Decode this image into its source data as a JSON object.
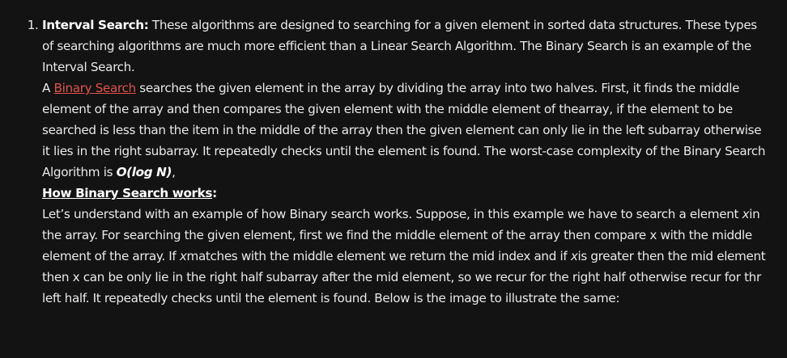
{
  "item_number": "1.",
  "intro": {
    "term": "Interval Search:",
    "text": " These algorithms are designed to searching for a given element in sorted data structures. These types of searching algorithms are much more efficient than a Linear Search Algorithm. The Binary Search is an example of the Interval Search."
  },
  "binary": {
    "prefix": "A ",
    "link_text": "Binary Search",
    "text": " searches the given element in the array by dividing the array into two halves. First, it finds the middle element of the array and then compares the given element with the middle element of thearray, if the element to be searched is less than the item in the middle of the array then the given element can only lie in the left subarray otherwise it lies in the right subarray. It repeatedly checks until the element is found. The worst-case complexity of the Binary Search Algorithm is ",
    "complexity": "O(log N)",
    "suffix": ","
  },
  "how": {
    "heading": "How Binary Search works",
    "colon": ":"
  },
  "example": {
    "t1": "Let’s understand with an example of how Binary search works. Suppose, in this example we have to search a element ",
    "x1": "x",
    "t2": "in the array. For searching the given element, first we find the middle element of the array then compare x with the middle element of the array. If ",
    "x2": "x",
    "t3": "matches with the middle element we return the mid index and if ",
    "x3": "x",
    "t4": "is greater then the mid element then x can be only lie in the right half subarray after the mid element, so we recur for the right half otherwise recur for thr left half. It repeatedly checks until the element is found. Below is the image to illustrate the same:"
  },
  "colors": {
    "background": "#131313",
    "text": "#e8e8e8",
    "link": "#e0524a"
  }
}
